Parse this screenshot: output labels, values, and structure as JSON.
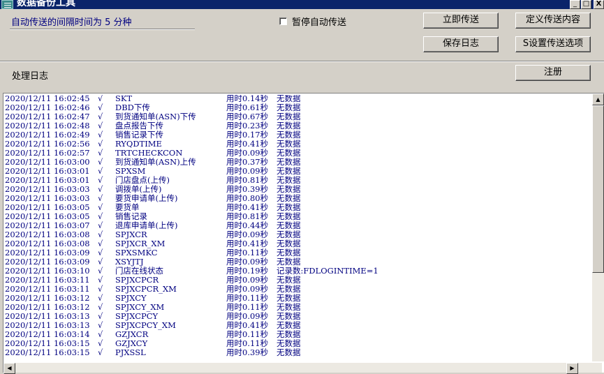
{
  "window": {
    "title": "数据备份工具",
    "controls": [
      "_",
      "□",
      "X"
    ]
  },
  "settings": {
    "interval_label": "自动传送的间隔时间为 5 分种",
    "pause_label": "暂停自动传送",
    "pause_checked": false
  },
  "buttons": {
    "send_now": "立即传送",
    "define_content": "定义传送内容",
    "save_log": "保存日志",
    "set_options": "S设置传送选项",
    "register": "注册"
  },
  "log": {
    "title": "处理日志",
    "rows": [
      [
        "2020/12/11 16:02:45",
        "√",
        "SKT",
        "用时0.14秒",
        "无数据"
      ],
      [
        "2020/12/11 16:02:46",
        "√",
        "DBD下传",
        "用时0.61秒",
        "无数据"
      ],
      [
        "2020/12/11 16:02:47",
        "√",
        "到货通知单(ASN)下传",
        "用时0.67秒",
        "无数据"
      ],
      [
        "2020/12/11 16:02:48",
        "√",
        "盘点报告下传",
        "用时0.23秒",
        "无数据"
      ],
      [
        "2020/12/11 16:02:49",
        "√",
        "销售记录下传",
        "用时0.17秒",
        "无数据"
      ],
      [
        "2020/12/11 16:02:56",
        "√",
        "RYQDTIME",
        "用时0.41秒",
        "无数据"
      ],
      [
        "2020/12/11 16:02:57",
        "√",
        "TRTCHECKCON",
        "用时0.09秒",
        "无数据"
      ],
      [
        "2020/12/11 16:03:00",
        "√",
        "到货通知单(ASN)上传",
        "用时0.37秒",
        "无数据"
      ],
      [
        "2020/12/11 16:03:01",
        "√",
        "SPXSM",
        "用时0.09秒",
        "无数据"
      ],
      [
        "2020/12/11 16:03:01",
        "√",
        "门店盘点(上传)",
        "用时0.81秒",
        "无数据"
      ],
      [
        "2020/12/11 16:03:03",
        "√",
        "调拨单(上传)",
        "用时0.39秒",
        "无数据"
      ],
      [
        "2020/12/11 16:03:03",
        "√",
        "要货申请单(上传)",
        "用时0.80秒",
        "无数据"
      ],
      [
        "2020/12/11 16:03:05",
        "√",
        "要货单",
        "用时0.41秒",
        "无数据"
      ],
      [
        "2020/12/11 16:03:05",
        "√",
        "销售记录",
        "用时0.81秒",
        "无数据"
      ],
      [
        "2020/12/11 16:03:07",
        "√",
        "退库申请单(上传)",
        "用时0.44秒",
        "无数据"
      ],
      [
        "2020/12/11 16:03:08",
        "√",
        "SPJXCR",
        "用时0.09秒",
        "无数据"
      ],
      [
        "2020/12/11 16:03:08",
        "√",
        "SPJXCR_XM",
        "用时0.41秒",
        "无数据"
      ],
      [
        "2020/12/11 16:03:09",
        "√",
        "SPXSMKC",
        "用时0.11秒",
        "无数据"
      ],
      [
        "2020/12/11 16:03:09",
        "√",
        "XSYJTJ",
        "用时0.09秒",
        "无数据"
      ],
      [
        "2020/12/11 16:03:10",
        "√",
        "门店在线状态",
        "用时0.19秒",
        "记录数:FDLOGINTIME=1"
      ],
      [
        "2020/12/11 16:03:11",
        "√",
        "SPJXCPCR",
        "用时0.09秒",
        "无数据"
      ],
      [
        "2020/12/11 16:03:11",
        "√",
        "SPJXCPCR_XM",
        "用时0.09秒",
        "无数据"
      ],
      [
        "2020/12/11 16:03:12",
        "√",
        "SPJXCY",
        "用时0.11秒",
        "无数据"
      ],
      [
        "2020/12/11 16:03:12",
        "√",
        "SPJXCY_XM",
        "用时0.11秒",
        "无数据"
      ],
      [
        "2020/12/11 16:03:13",
        "√",
        "SPJXCPCY",
        "用时0.09秒",
        "无数据"
      ],
      [
        "2020/12/11 16:03:13",
        "√",
        "SPJXCPCY_XM",
        "用时0.41秒",
        "无数据"
      ],
      [
        "2020/12/11 16:03:14",
        "√",
        "GZJXCR",
        "用时0.11秒",
        "无数据"
      ],
      [
        "2020/12/11 16:03:15",
        "√",
        "GZJXCY",
        "用时0.11秒",
        "无数据"
      ],
      [
        "2020/12/11 16:03:15",
        "√",
        "PJXSSL",
        "用时0.39秒",
        "无数据"
      ]
    ]
  },
  "colors": {
    "log_text": "#000080",
    "title_bar": "#0a246a",
    "window_bg": "#d4d0c8"
  }
}
